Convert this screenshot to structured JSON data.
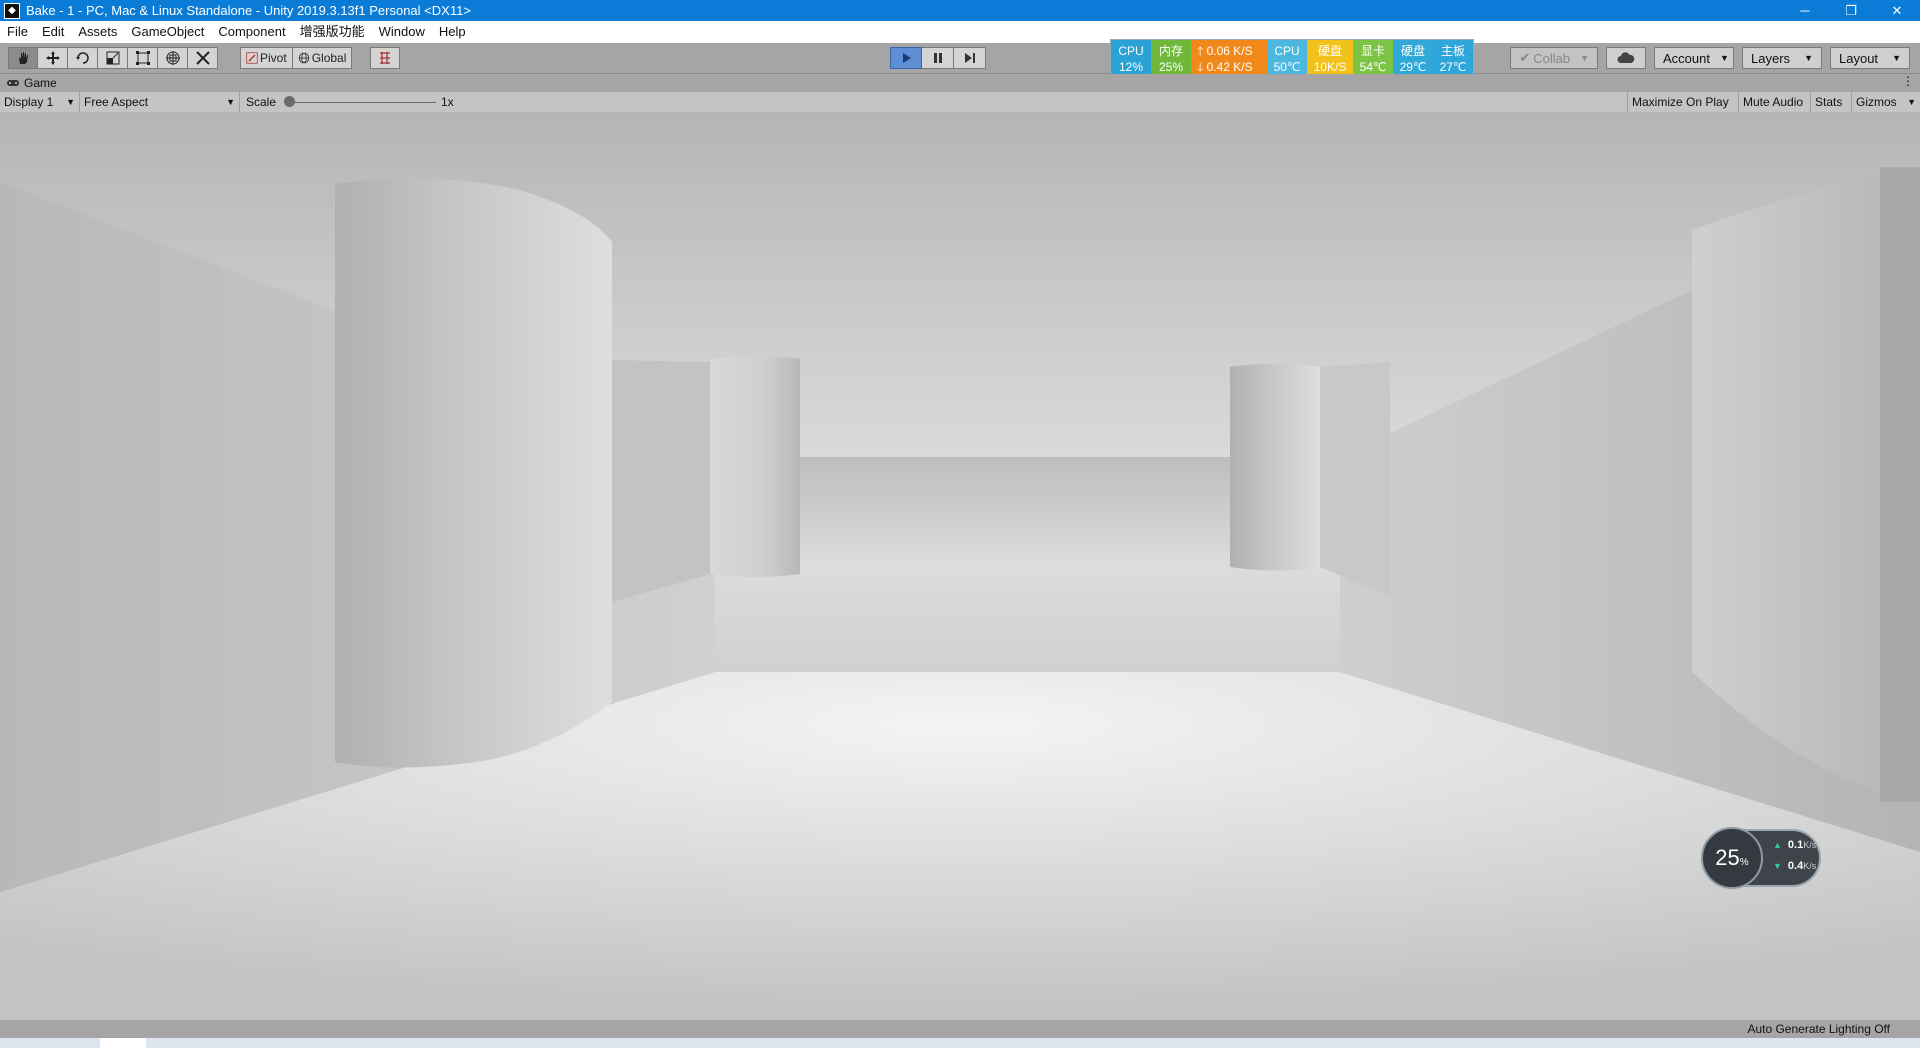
{
  "window": {
    "title": "Bake - 1 - PC, Mac & Linux Standalone - Unity 2019.3.13f1 Personal <DX11>",
    "controls": {
      "minimize": "─",
      "restore": "❐",
      "close": "✕"
    }
  },
  "menu": [
    "File",
    "Edit",
    "Assets",
    "GameObject",
    "Component",
    "增强版功能",
    "Window",
    "Help"
  ],
  "toolbar": {
    "pivot": "Pivot",
    "global": "Global",
    "right": {
      "collab": "Collab",
      "account": "Account",
      "layers": "Layers",
      "layout": "Layout"
    }
  },
  "monitor": {
    "cpu_label": "CPU",
    "cpu_value": "12%",
    "mem_label": "内存",
    "mem_value": "25%",
    "up_rate": "0.06 K/S",
    "down_rate": "0.42 K/S",
    "cpu_temp_label": "CPU",
    "cpu_temp": "50℃",
    "disk_label": "硬盘",
    "disk_rate": "10K/S",
    "gpu_label": "显卡",
    "gpu_temp": "54℃",
    "disk2_label": "硬盘",
    "disk2_temp": "29℃",
    "board_label": "主板",
    "board_temp": "27℃",
    "colors": {
      "cpu": "#2aa2d6",
      "mem": "#6fb83a",
      "net": "#f0891a",
      "cpu_temp": "#4cb8e0",
      "disk": "#f3c21a",
      "gpu": "#7cc444",
      "disk2": "#30a8d8",
      "board": "#2fa6d9"
    }
  },
  "game_tab": {
    "label": "Game"
  },
  "game_bar": {
    "display": "Display 1",
    "aspect": "Free Aspect",
    "scale_label": "Scale",
    "scale_value": "1x",
    "maximize": "Maximize On Play",
    "mute": "Mute Audio",
    "stats": "Stats",
    "gizmos": "Gizmos"
  },
  "net_gauge": {
    "percent": "25",
    "percent_unit": "%",
    "up": "0.1",
    "down": "0.4",
    "unit": "K/s"
  },
  "status": {
    "lighting": "Auto Generate Lighting Off"
  }
}
